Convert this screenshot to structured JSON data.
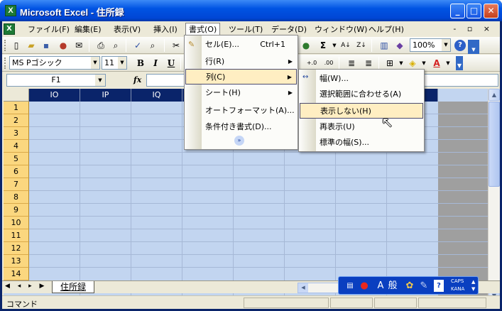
{
  "window": {
    "title": "Microsoft Excel - 住所録",
    "app_icon_glyph": "X",
    "min_glyph": "_",
    "max_glyph": "□",
    "close_glyph": "✕"
  },
  "menubar": {
    "items": [
      "ファイル(F)",
      "編集(E)",
      "表示(V)",
      "挿入(I)",
      "書式(O)",
      "ツール(T)",
      "データ(D)",
      "ウィンドウ(W)",
      "ヘルプ(H)"
    ],
    "mdi_controls": "- ▫ ×"
  },
  "toolbar_standard": {
    "zoom": "100%",
    "sigma": "Σ",
    "help_glyph": "?"
  },
  "toolbar_formatting": {
    "font_name": "MS Pゴシック",
    "font_size": "11",
    "bold": "B",
    "italic": "I",
    "underline": "U",
    "font_color_glyph": "A"
  },
  "formula_bar": {
    "name_box": "F1",
    "fx": "fx"
  },
  "grid": {
    "columns": [
      "IO",
      "IP",
      "IQ"
    ],
    "rows": [
      "1",
      "2",
      "3",
      "4",
      "5",
      "6",
      "7",
      "8",
      "9",
      "10",
      "11",
      "12",
      "13",
      "14"
    ]
  },
  "format_menu": {
    "items": [
      {
        "label": "セル(E)...",
        "shortcut": "Ctrl+1",
        "submenu": false
      },
      {
        "label": "行(R)",
        "shortcut": "",
        "submenu": true
      },
      {
        "label": "列(C)",
        "shortcut": "",
        "submenu": true
      },
      {
        "label": "シート(H)",
        "shortcut": "",
        "submenu": true
      },
      {
        "label": "オートフォーマット(A)...",
        "shortcut": "",
        "submenu": false
      },
      {
        "label": "条件付き書式(D)...",
        "shortcut": "",
        "submenu": false
      }
    ],
    "expand_glyph": "»"
  },
  "column_submenu": {
    "items": [
      "幅(W)...",
      "選択範囲に合わせる(A)",
      "表示しない(H)",
      "再表示(U)",
      "標準の幅(S)..."
    ],
    "highlighted_index": 2
  },
  "sheet_tabs": {
    "nav": "◀ ◂ ▸ ▶",
    "active": "住所録"
  },
  "language_bar": {
    "ime_mode": "A",
    "ime_label": "般",
    "caps": "CAPS",
    "kana": "KANA"
  },
  "statusbar": {
    "text": "コマンド"
  },
  "colors": {
    "title_blue": "#0054e3",
    "selection_fill": "#c2d5f0",
    "row_header_selected": "#fbd77f",
    "menu_highlight": "#ffeec2"
  }
}
